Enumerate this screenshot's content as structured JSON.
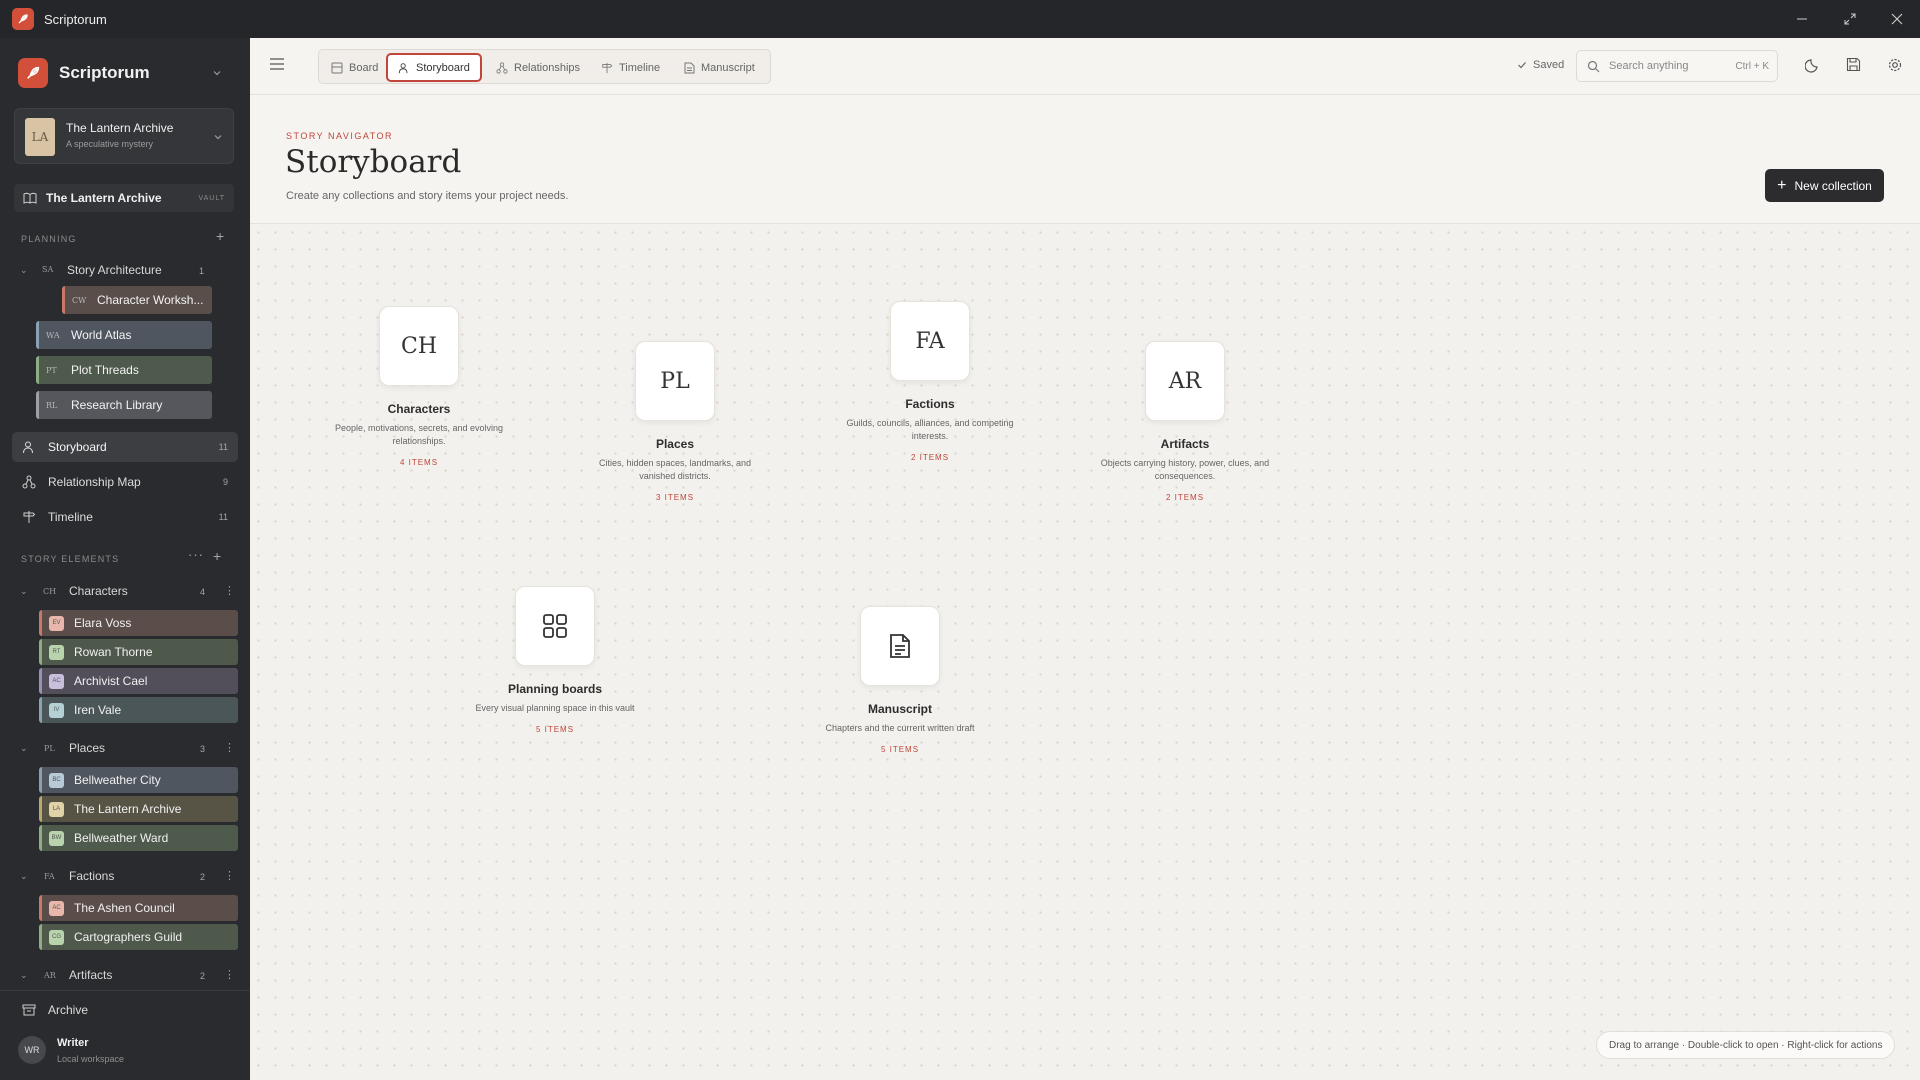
{
  "window": {
    "title": "Scriptorum"
  },
  "sidebar": {
    "brand": "Scriptorum",
    "project": {
      "initials": "LA",
      "name": "The Lantern Archive",
      "subtitle": "A speculative mystery"
    },
    "vault": {
      "label": "The Lantern Archive",
      "badge": "VAULT"
    },
    "planning": {
      "heading": "PLANNING",
      "group": {
        "abbr": "SA",
        "label": "Story Architecture",
        "count": "1"
      },
      "boards": [
        {
          "abbr": "CW",
          "label": "Character Worksh..."
        },
        {
          "abbr": "WA",
          "label": "World Atlas"
        },
        {
          "abbr": "PT",
          "label": "Plot Threads"
        },
        {
          "abbr": "RL",
          "label": "Research Library"
        }
      ]
    },
    "nav": [
      {
        "label": "Storyboard",
        "count": "11",
        "icon": "storyboard-icon"
      },
      {
        "label": "Relationship Map",
        "count": "9",
        "icon": "relationship-icon"
      },
      {
        "label": "Timeline",
        "count": "11",
        "icon": "timeline-icon"
      }
    ],
    "elements": {
      "heading": "STORY ELEMENTS",
      "groups": [
        {
          "abbr": "CH",
          "label": "Characters",
          "count": "4",
          "items": [
            {
              "initials": "EV",
              "label": "Elara Voss"
            },
            {
              "initials": "RT",
              "label": "Rowan Thorne"
            },
            {
              "initials": "AC",
              "label": "Archivist Cael"
            },
            {
              "initials": "IV",
              "label": "Iren Vale"
            }
          ]
        },
        {
          "abbr": "PL",
          "label": "Places",
          "count": "3",
          "items": [
            {
              "initials": "BC",
              "label": "Bellweather City"
            },
            {
              "initials": "LA",
              "label": "The Lantern Archive"
            },
            {
              "initials": "BW",
              "label": "Bellweather Ward"
            }
          ]
        },
        {
          "abbr": "FA",
          "label": "Factions",
          "count": "2",
          "items": [
            {
              "initials": "AC",
              "label": "The Ashen Council"
            },
            {
              "initials": "CG",
              "label": "Cartographers Guild"
            }
          ]
        },
        {
          "abbr": "AR",
          "label": "Artifacts",
          "count": "2",
          "items": []
        }
      ]
    },
    "archive": "Archive",
    "user": {
      "initials": "WR",
      "name": "Writer",
      "subtitle": "Local workspace"
    }
  },
  "topbar": {
    "tabs": [
      {
        "label": "Board",
        "icon": "board-icon"
      },
      {
        "label": "Storyboard",
        "icon": "storyboard-icon",
        "active": true
      },
      {
        "label": "Relationships",
        "icon": "relationships-icon"
      },
      {
        "label": "Timeline",
        "icon": "timeline-icon"
      },
      {
        "label": "Manuscript",
        "icon": "manuscript-icon"
      }
    ],
    "saved": "Saved",
    "search": {
      "placeholder": "Search anything",
      "shortcut": "Ctrl + K"
    }
  },
  "header": {
    "eyebrow": "STORY NAVIGATOR",
    "title": "Storyboard",
    "description": "Create any collections and story items your project needs.",
    "new_button": "New collection"
  },
  "collections": [
    {
      "initials": "CH",
      "title": "Characters",
      "description": "People, motivations, secrets, and evolving relationships.",
      "count": "4 ITEMS"
    },
    {
      "initials": "PL",
      "title": "Places",
      "description": "Cities, hidden spaces, landmarks, and vanished districts.",
      "count": "3 ITEMS"
    },
    {
      "initials": "FA",
      "title": "Factions",
      "description": "Guilds, councils, alliances, and competing interests.",
      "count": "2 ITEMS"
    },
    {
      "initials": "AR",
      "title": "Artifacts",
      "description": "Objects carrying history, power, clues, and consequences.",
      "count": "2 ITEMS"
    },
    {
      "icon": "grid-icon",
      "title": "Planning boards",
      "description": "Every visual planning space in this vault",
      "count": "5 ITEMS"
    },
    {
      "icon": "document-icon",
      "title": "Manuscript",
      "description": "Chapters and the current written draft",
      "count": "5 ITEMS"
    }
  ],
  "hint": "Drag to arrange · Double-click to open · Right-click for actions",
  "colors": {
    "accent": "#c0453a",
    "brand": "#d2503a",
    "sidebar": "#2a2b2e",
    "titlebar": "#25262a"
  }
}
